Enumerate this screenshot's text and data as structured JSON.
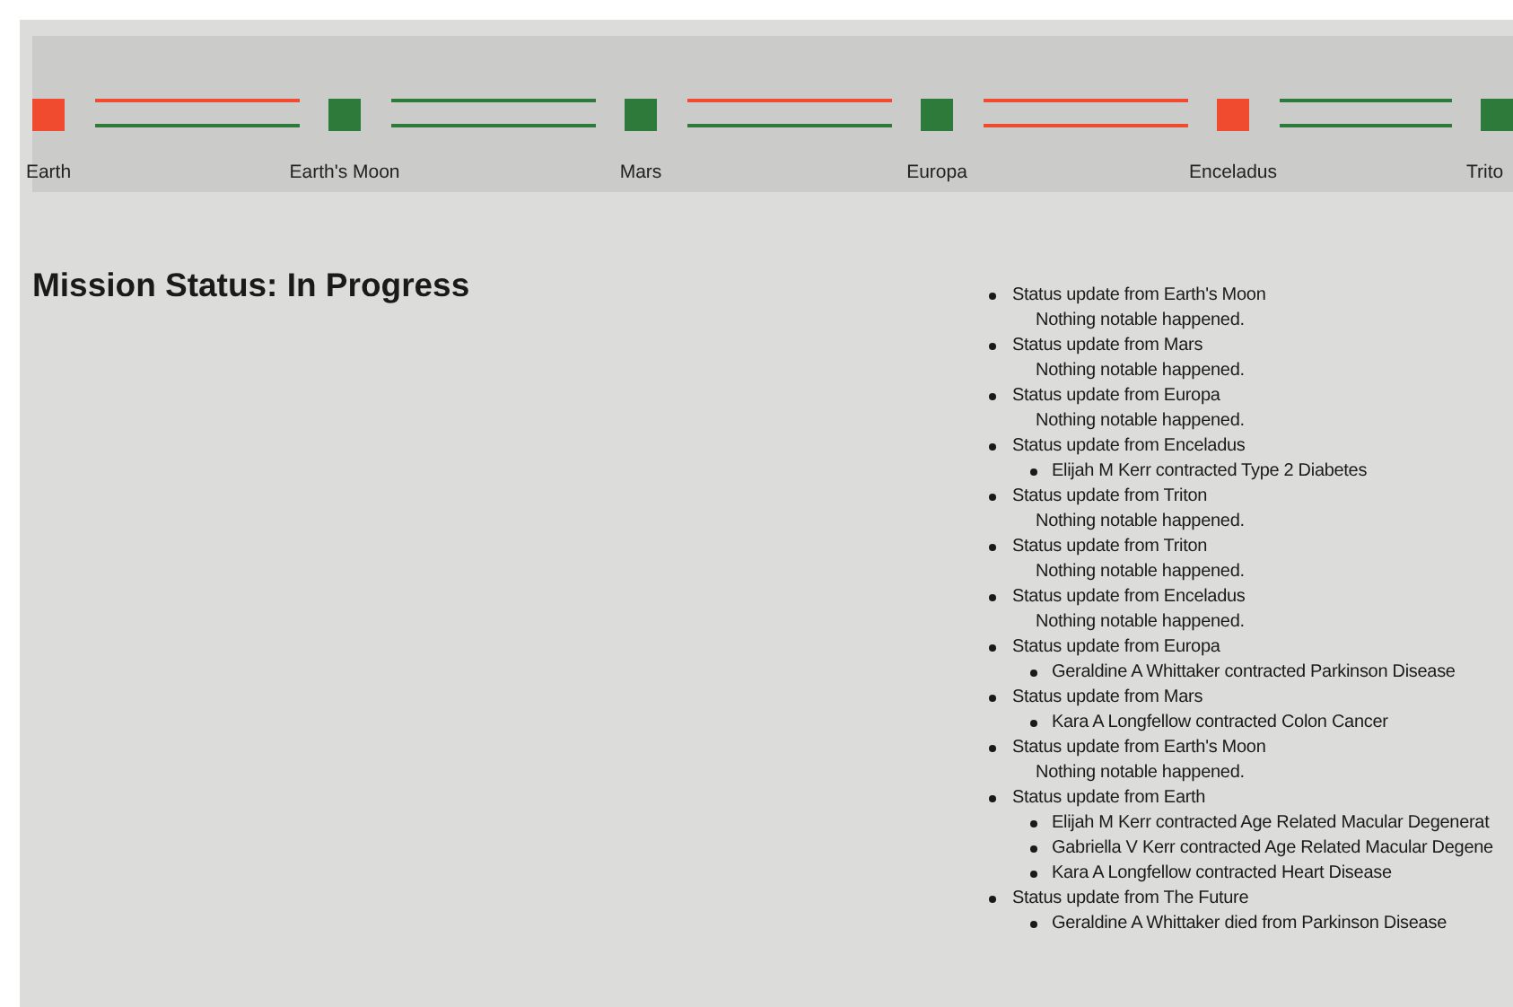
{
  "timeline": {
    "stops": [
      {
        "name": "Earth",
        "color": "#f04a2f"
      },
      {
        "name": "Earth's Moon",
        "color": "#2e7a3a"
      },
      {
        "name": "Mars",
        "color": "#2e7a3a"
      },
      {
        "name": "Europa",
        "color": "#2e7a3a"
      },
      {
        "name": "Enceladus",
        "color": "#f04a2f"
      },
      {
        "name": "Trito",
        "color": "#2e7a3a"
      }
    ],
    "segments": [
      {
        "lines": [
          {
            "color": "#f04a2f"
          },
          {
            "color": "#2e7a3a"
          }
        ]
      },
      {
        "lines": [
          {
            "color": "#2e7a3a"
          },
          {
            "color": "#2e7a3a"
          }
        ]
      },
      {
        "lines": [
          {
            "color": "#f04a2f"
          },
          {
            "color": "#2e7a3a"
          }
        ]
      },
      {
        "lines": [
          {
            "color": "#f04a2f"
          },
          {
            "color": "#f04a2f"
          }
        ]
      },
      {
        "lines": [
          {
            "color": "#2e7a3a"
          },
          {
            "color": "#2e7a3a"
          }
        ]
      }
    ]
  },
  "heading": "Mission Status: In Progress",
  "updates": [
    {
      "title": "Status update from Earth's Moon",
      "kind": "note",
      "note": "Nothing notable happened."
    },
    {
      "title": "Status update from Mars",
      "kind": "note",
      "note": "Nothing notable happened."
    },
    {
      "title": "Status update from Europa",
      "kind": "note",
      "note": "Nothing notable happened."
    },
    {
      "title": "Status update from Enceladus",
      "kind": "events",
      "events": [
        "Elijah M Kerr contracted Type 2 Diabetes"
      ]
    },
    {
      "title": "Status update from Triton",
      "kind": "note",
      "note": "Nothing notable happened."
    },
    {
      "title": "Status update from Triton",
      "kind": "note",
      "note": "Nothing notable happened."
    },
    {
      "title": "Status update from Enceladus",
      "kind": "note",
      "note": "Nothing notable happened."
    },
    {
      "title": "Status update from Europa",
      "kind": "events",
      "events": [
        "Geraldine A Whittaker contracted Parkinson Disease"
      ]
    },
    {
      "title": "Status update from Mars",
      "kind": "events",
      "events": [
        "Kara A Longfellow contracted Colon Cancer"
      ]
    },
    {
      "title": "Status update from Earth's Moon",
      "kind": "note",
      "note": "Nothing notable happened."
    },
    {
      "title": "Status update from Earth",
      "kind": "events",
      "events": [
        "Elijah M Kerr contracted Age Related Macular Degenerat",
        "Gabriella V Kerr contracted Age Related Macular Degene",
        "Kara A Longfellow contracted Heart Disease"
      ]
    },
    {
      "title": "Status update from The Future",
      "kind": "events",
      "events": [
        "Geraldine A Whittaker died from Parkinson Disease"
      ]
    }
  ]
}
